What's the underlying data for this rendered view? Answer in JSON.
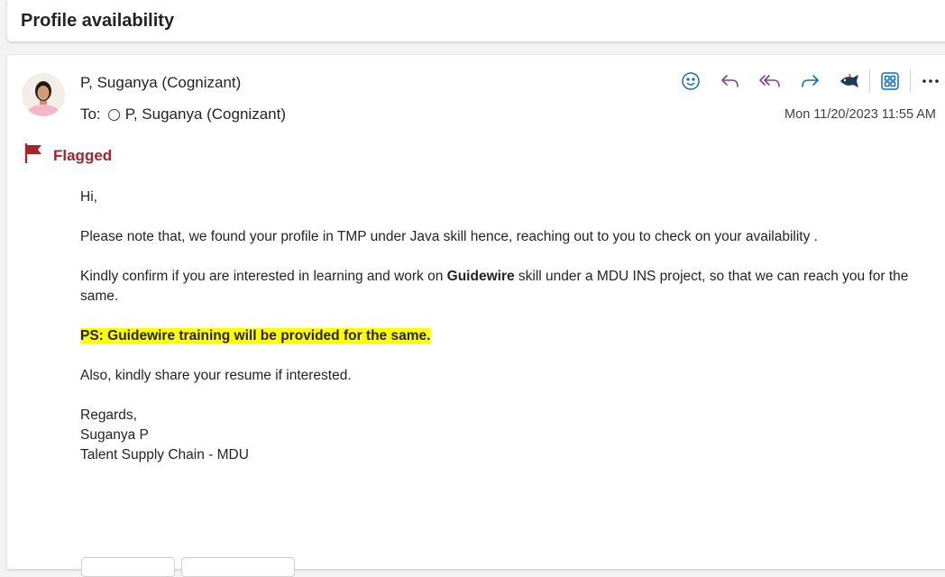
{
  "subject": "Profile availability",
  "sender": {
    "name": "P, Suganya (Cognizant)"
  },
  "recipients": {
    "label": "To:",
    "name": "P, Suganya (Cognizant)"
  },
  "timestamp": "Mon 11/20/2023 11:55 AM",
  "flag": {
    "label": "Flagged",
    "color": "#a4262c"
  },
  "toolbar": {
    "icons": [
      "smiley-icon",
      "reply-icon",
      "reply-all-icon",
      "forward-icon",
      "phish-report-icon",
      "apps-icon",
      "more-icon"
    ],
    "accent_color": "#0f6cbd",
    "reply_color": "#8a3d9a"
  },
  "body": {
    "greeting": "Hi,",
    "p1": "Please note that, we found your profile in TMP under Java skill hence, reaching out to you to check on your availability .",
    "p2_before": "Kindly confirm if you are interested in learning and work on ",
    "p2_bold": "Guidewire",
    "p2_after": " skill under a MDU INS project, so that we can reach you for the same.",
    "ps": "PS: Guidewire training will be provided for the same.",
    "p3": "Also, kindly share your resume if interested.",
    "closing": "Regards,",
    "signature_name": "Suganya P",
    "signature_team": "Talent Supply Chain - MDU"
  },
  "highlight_color": "#ffff00"
}
